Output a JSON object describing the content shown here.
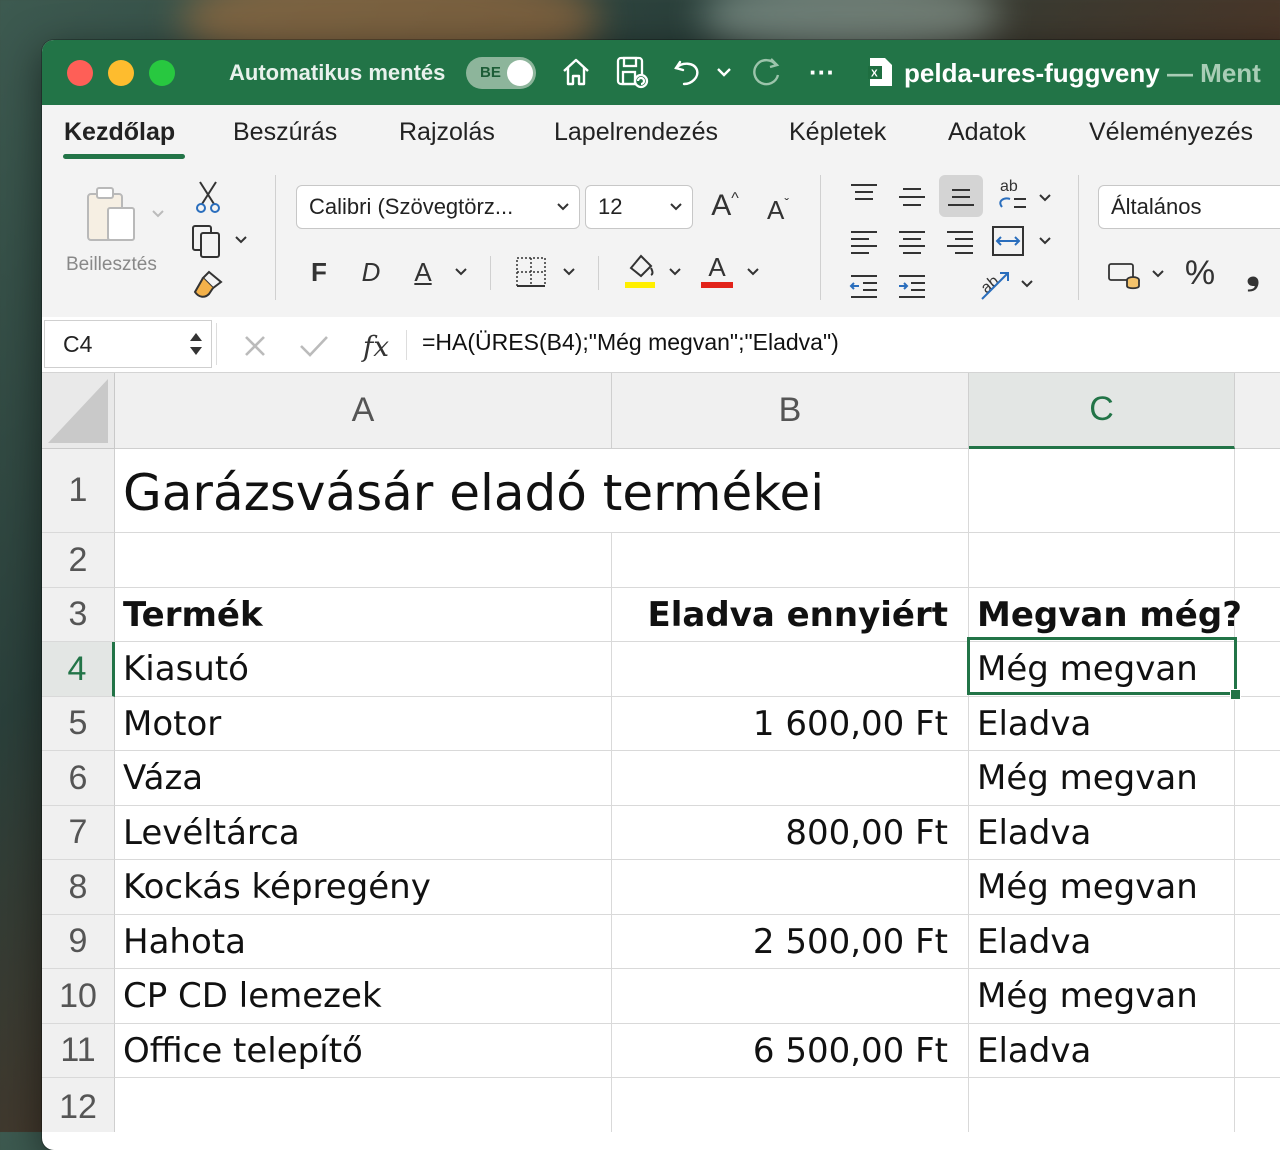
{
  "titlebar": {
    "autosave_label": "Automatikus mentés",
    "autosave_state": "BE",
    "more": "···",
    "doc_name": "pelda-ures-fuggveny",
    "doc_suffix": " — Ment",
    "icons": [
      "home-icon",
      "save-icon",
      "undo-icon",
      "redo-icon",
      "more-icon",
      "excel-file-icon"
    ]
  },
  "tabs": [
    {
      "label": "Kezdőlap",
      "active": true
    },
    {
      "label": "Beszúrás"
    },
    {
      "label": "Rajzolás"
    },
    {
      "label": "Lapelrendezés"
    },
    {
      "label": "Képletek"
    },
    {
      "label": "Adatok"
    },
    {
      "label": "Véleményezés"
    }
  ],
  "ribbon": {
    "paste_label": "Beillesztés",
    "font_name": "Calibri (Szövegtörz...",
    "font_size": "12",
    "grow_font": "A",
    "shrink_font": "A",
    "bold": "F",
    "italic": "D",
    "underline": "A",
    "font_color": "A",
    "wrap_text": "ab",
    "number_format": "Általános",
    "percent": "%",
    "comma": "❟",
    "highlight_color": "#ffef00",
    "font_color_value": "#e2231a"
  },
  "formula_bar": {
    "name_box": "C4",
    "fx": "fx",
    "formula": "=HA(ÜRES(B4);\"Még megvan\";\"Eladva\")"
  },
  "sheet": {
    "columns": [
      "A",
      "B",
      "C"
    ],
    "selected_column": "C",
    "selected_row": 4,
    "rows": [
      {
        "n": "1",
        "a": "Garázsvásár eladó termékei",
        "b": "",
        "c": ""
      },
      {
        "n": "2",
        "a": "",
        "b": "",
        "c": ""
      },
      {
        "n": "3",
        "a": "Termék",
        "b": "Eladva ennyiért",
        "c": "Megvan még?"
      },
      {
        "n": "4",
        "a": "Kiasutó",
        "b": "",
        "c": "Még megvan"
      },
      {
        "n": "5",
        "a": "Motor",
        "b": "1 600,00 Ft",
        "c": "Eladva"
      },
      {
        "n": "6",
        "a": "Váza",
        "b": "",
        "c": "Még megvan"
      },
      {
        "n": "7",
        "a": "Levéltárca",
        "b": "800,00 Ft",
        "c": "Eladva"
      },
      {
        "n": "8",
        "a": "Kockás képregény",
        "b": "",
        "c": "Még megvan"
      },
      {
        "n": "9",
        "a": "Hahota",
        "b": "2 500,00 Ft",
        "c": "Eladva"
      },
      {
        "n": "10",
        "a": "CP CD lemezek",
        "b": "",
        "c": "Még megvan"
      },
      {
        "n": "11",
        "a": "Office telepítő",
        "b": "6 500,00 Ft",
        "c": "Eladva"
      },
      {
        "n": "12",
        "a": "",
        "b": "",
        "c": ""
      }
    ]
  },
  "colors": {
    "excel_green": "#227447"
  }
}
